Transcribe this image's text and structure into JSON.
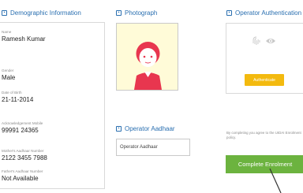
{
  "demographic": {
    "title": "Demographic Information",
    "fields": [
      {
        "label": "Name",
        "value": "Ramesh Kumar"
      },
      {
        "label": "Gender",
        "value": "Male"
      },
      {
        "label": "Date of Birth",
        "value": "21-11-2014"
      },
      {
        "label": "Acknowledgement Mobile",
        "value": "99991 24365"
      },
      {
        "label": "Mother's Aadhaar Number",
        "value": "2122 3455 7988"
      },
      {
        "label": "Father's Aadhaar Number",
        "value": "Not Available"
      }
    ]
  },
  "photograph": {
    "title": "Photograph"
  },
  "operator_auth": {
    "title": "Operator Authentication",
    "authenticate_label": "Authenticate"
  },
  "operator_aadhaar": {
    "title": "Operator Aadhaar",
    "placeholder": "Operator Aadhaar"
  },
  "consent_text": "By completing you agree to the UIDAI Enrolment policy.",
  "complete_label": "Complete Enrolment",
  "colors": {
    "accent_blue": "#2a6fb0",
    "avatar_red": "#e8364f",
    "photo_bg": "#fffbd8",
    "authenticate_yellow": "#f3ba0f",
    "complete_green": "#6cb33f"
  }
}
